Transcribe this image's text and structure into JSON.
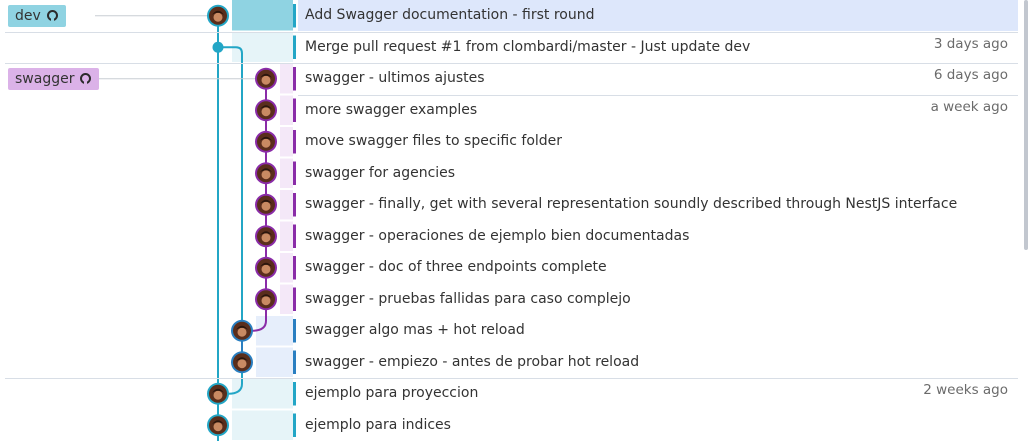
{
  "refs": [
    {
      "label": "dev",
      "row": 0,
      "color": "#8fd3e2",
      "icon": "github-icon"
    },
    {
      "label": "swagger",
      "row": 2,
      "color": "#dbb2e8",
      "icon": "github-icon"
    }
  ],
  "commits": [
    {
      "message": "Add Swagger documentation - first round",
      "date": "",
      "lane": 0,
      "kind": "avatar",
      "band": "dev"
    },
    {
      "message": "Merge pull request #1 from clombardi/master - Just update dev",
      "date": "3 days ago",
      "lane": 0,
      "kind": "merge-dot",
      "band": "dev"
    },
    {
      "message": "swagger - ultimos ajustes",
      "date": "6 days ago",
      "lane": 2,
      "kind": "avatar",
      "band": "swagger"
    },
    {
      "message": "more swagger examples",
      "date": "a week ago",
      "lane": 2,
      "kind": "avatar",
      "band": "swagger"
    },
    {
      "message": "move swagger files to specific folder",
      "date": "",
      "lane": 2,
      "kind": "avatar",
      "band": "swagger"
    },
    {
      "message": "swagger for agencies",
      "date": "",
      "lane": 2,
      "kind": "avatar",
      "band": "swagger"
    },
    {
      "message": "swagger - finally, get with several representation soundly described through NestJS interface",
      "date": "",
      "lane": 2,
      "kind": "avatar",
      "band": "swagger"
    },
    {
      "message": "swagger - operaciones de ejemplo bien documentadas",
      "date": "",
      "lane": 2,
      "kind": "avatar",
      "band": "swagger"
    },
    {
      "message": "swagger - doc of three endpoints complete",
      "date": "",
      "lane": 2,
      "kind": "avatar",
      "band": "swagger"
    },
    {
      "message": "swagger - pruebas fallidas para caso complejo",
      "date": "",
      "lane": 2,
      "kind": "avatar",
      "band": "swagger"
    },
    {
      "message": "swagger algo mas + hot reload",
      "date": "",
      "lane": 1,
      "kind": "avatar",
      "band": "blue"
    },
    {
      "message": "swagger - empiezo - antes de probar hot reload",
      "date": "",
      "lane": 1,
      "kind": "avatar",
      "band": "blue"
    },
    {
      "message": "ejemplo para proyeccion",
      "date": "2 weeks ago",
      "lane": 0,
      "kind": "avatar",
      "band": "teal"
    },
    {
      "message": "ejemplo para indices",
      "date": "",
      "lane": 0,
      "kind": "avatar",
      "band": "teal"
    }
  ],
  "colors": {
    "lane_dev": "#23a6c6",
    "lane_swagger": "#8a2ca8",
    "lane_blue": "#2a7fc1",
    "band_dev": "#e6f4f8",
    "band_swagger": "#f4e8f8",
    "band_blue": "#e6eefb",
    "band_teal": "#e6f4f8",
    "selected_row": "#dde7fb",
    "selected_band": "#8fd3e2"
  },
  "selected_row": 0
}
